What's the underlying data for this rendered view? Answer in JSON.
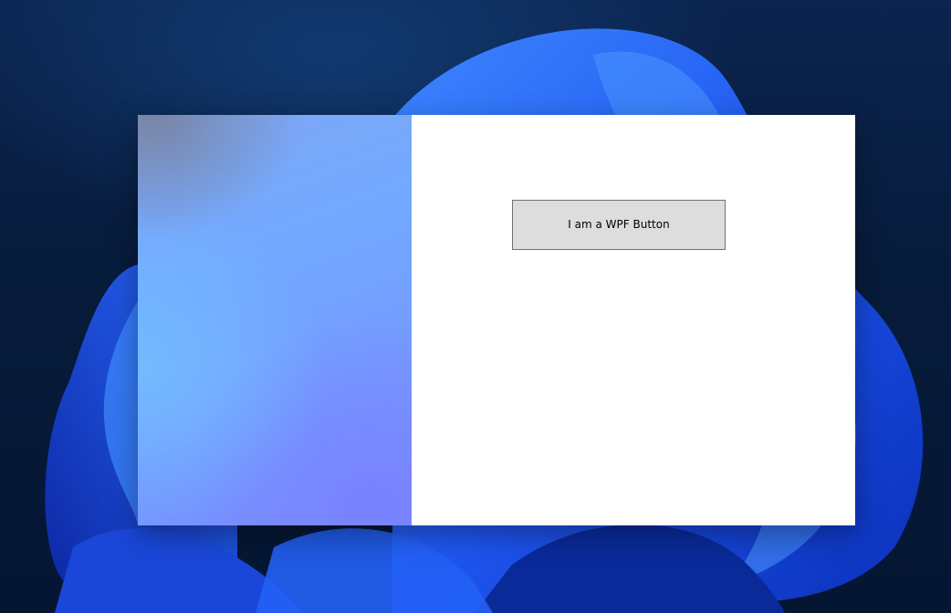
{
  "desktop": {
    "wallpaper": "windows-11-bloom",
    "colors": {
      "background": "#061a3a",
      "bloom_dark": "#0a2fb8",
      "bloom_mid": "#1f56f0",
      "bloom_light": "#3d86ff"
    }
  },
  "window": {
    "left_pane": {
      "style": "acrylic-gradient",
      "colors": [
        "#7fa6f2",
        "#72a9ff",
        "#7596ff",
        "#7a8cff"
      ]
    },
    "content": {
      "button": {
        "label": "I am a WPF Button"
      }
    }
  }
}
